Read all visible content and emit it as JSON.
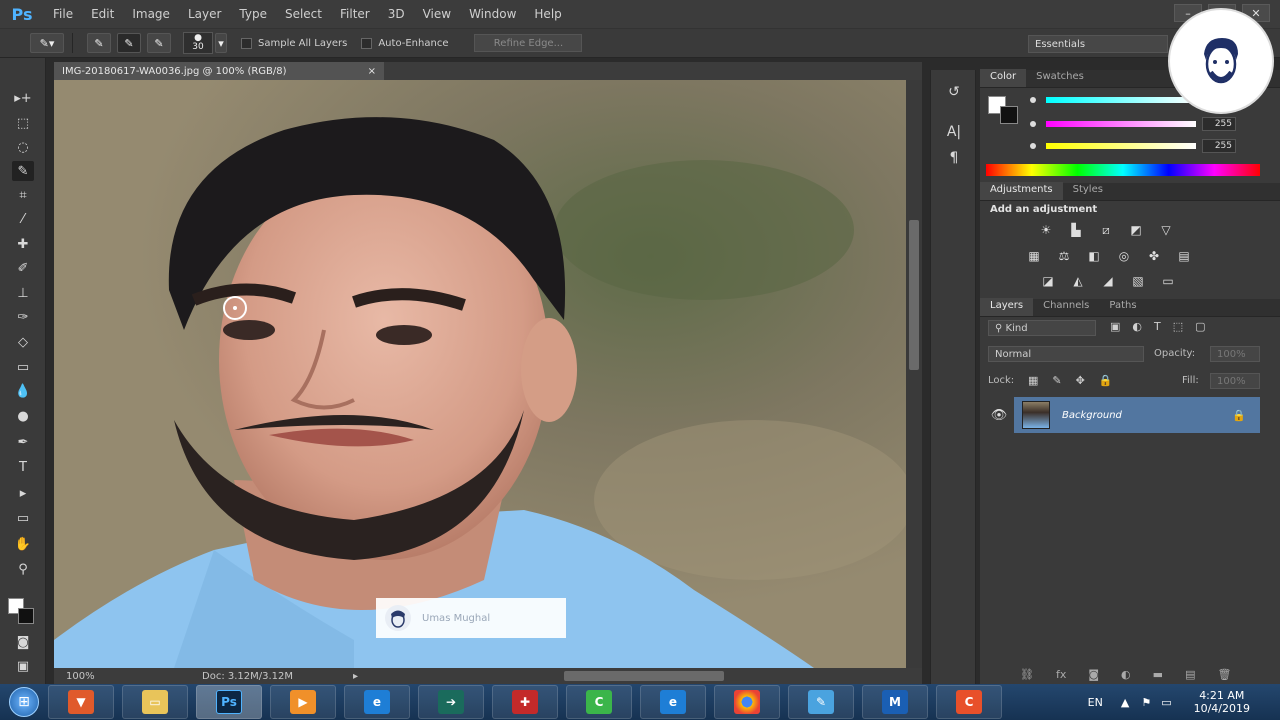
{
  "app": {
    "logo": "Ps"
  },
  "menu": [
    "File",
    "Edit",
    "Image",
    "Layer",
    "Type",
    "Select",
    "Filter",
    "3D",
    "View",
    "Window",
    "Help"
  ],
  "options": {
    "brush_size": "30",
    "sample_all_layers": "Sample All Layers",
    "auto_enhance": "Auto-Enhance",
    "refine_edge": "Refine Edge...",
    "workspace": "Essentials"
  },
  "document": {
    "tab_title": "IMG-20180617-WA0036.jpg @ 100% (RGB/8)",
    "zoom": "100%",
    "doc_size": "Doc: 3.12M/3.12M"
  },
  "color_panel": {
    "tabs": [
      "Color",
      "Swatches"
    ],
    "values": [
      "255",
      "255"
    ]
  },
  "adjustments_panel": {
    "tabs": [
      "Adjustments",
      "Styles"
    ],
    "heading": "Add an adjustment"
  },
  "layers_panel": {
    "tabs": [
      "Layers",
      "Channels",
      "Paths"
    ],
    "kind": "Kind",
    "blend_mode": "Normal",
    "opacity_label": "Opacity:",
    "opacity_value": "100%",
    "lock_label": "Lock:",
    "fill_label": "Fill:",
    "fill_value": "100%",
    "layer_name": "Background"
  },
  "watermark": {
    "text": "Umas Mughal"
  },
  "taskbar": {
    "lang": "EN",
    "time": "4:21 AM",
    "date": "10/4/2019"
  },
  "colors": {
    "accent": "#4fb3ff",
    "layer_selected": "#5276a0",
    "taskbar": "#1e3e62"
  }
}
